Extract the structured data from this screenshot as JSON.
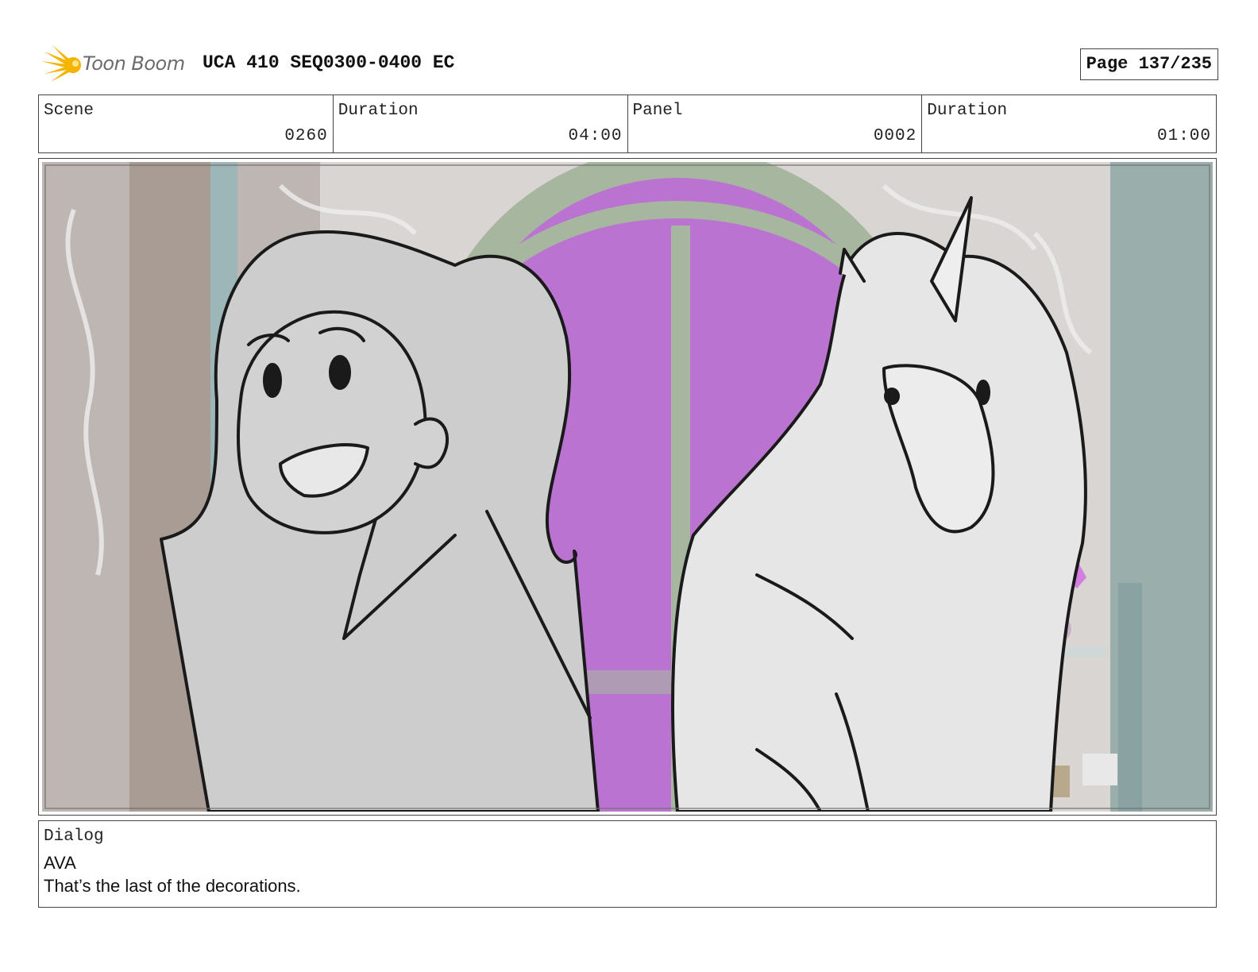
{
  "header": {
    "logo_text": "Toon Boom",
    "title": "UCA 410 SEQ0300-0400 EC",
    "page": "Page 137/235"
  },
  "info": {
    "scene_label": "Scene",
    "scene_value": "0260",
    "scene_duration_label": "Duration",
    "scene_duration_value": "04:00",
    "panel_label": "Panel",
    "panel_value": "0002",
    "panel_duration_label": "Duration",
    "panel_duration_value": "01:00"
  },
  "panel": {
    "icon": "storyboard-sketch-girl-and-unicorn",
    "colors": {
      "window": "#c07ad6",
      "frame": "#9fb09a",
      "wall": "#d6d2cf",
      "character_fill": "#cfcfcf",
      "unicorn_fill": "#e6e6e6",
      "line": "#1a1a1a"
    }
  },
  "dialog": {
    "label": "Dialog",
    "speaker": "AVA",
    "line": "That’s the last of the decorations."
  },
  "colors": {
    "logo": "#f5b400",
    "border": "#444444"
  }
}
